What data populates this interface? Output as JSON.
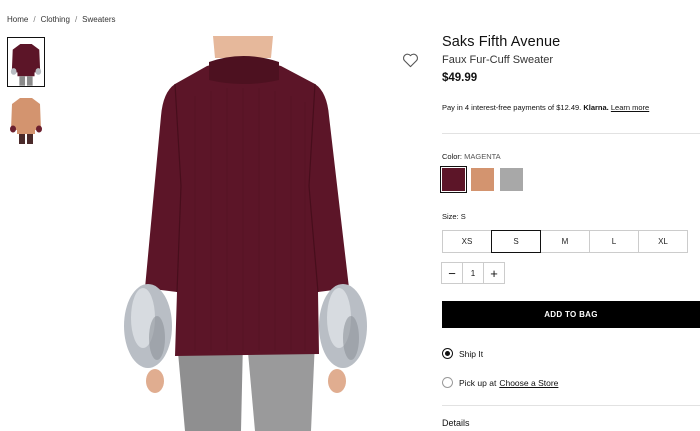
{
  "breadcrumb": {
    "items": [
      "Home",
      "Clothing",
      "Sweaters"
    ],
    "separator": "/"
  },
  "product": {
    "brand": "Saks Fifth Avenue",
    "name": "Faux Fur-Cuff Sweater",
    "price": "$49.99"
  },
  "klarna": {
    "prefix": "Pay in 4 interest-free payments of $12.49.",
    "logo": "Klarna.",
    "link": "Learn more"
  },
  "color": {
    "label": "Color:",
    "value": "MAGENTA",
    "swatches": [
      {
        "name": "Magenta",
        "hex": "#5c1528",
        "selected": true
      },
      {
        "name": "Camel",
        "hex": "#d3946f",
        "selected": false
      },
      {
        "name": "Grey",
        "hex": "#a8a8a8",
        "selected": false
      }
    ]
  },
  "size": {
    "label": "Size:",
    "value": "S",
    "options": [
      "XS",
      "S",
      "M",
      "L",
      "XL"
    ],
    "selected": "S"
  },
  "quantity": {
    "minus": "−",
    "value": "1",
    "plus": "+"
  },
  "add_to_bag": "ADD TO BAG",
  "fulfillment": {
    "ship": "Ship It",
    "pickup_prefix": "Pick up at",
    "pickup_link": "Choose a Store"
  },
  "details_label": "Details",
  "icons": {
    "wishlist": "heart-icon"
  },
  "colors": {
    "sweater": "#5c1528",
    "accent": "#000000"
  }
}
